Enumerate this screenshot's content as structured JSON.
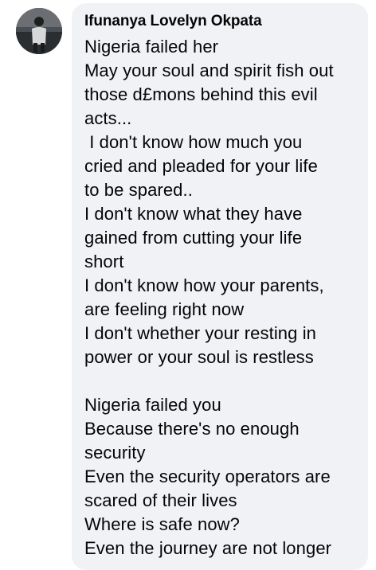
{
  "comment": {
    "avatar_icon": "user-avatar-photo",
    "author": "Ifunanya Lovelyn Okpata",
    "lines": [
      "Nigeria failed her",
      "May your soul and spirit fish out",
      "those d£mons behind this evil",
      "acts...",
      " I don't know how much you",
      "cried and pleaded for your life",
      "to be spared..",
      "I don't know what they have",
      "gained from cutting your life",
      "short",
      "I don't know how your parents,",
      "are feeling right now",
      "I don't whether your resting in",
      "power or your soul is restless",
      "",
      "Nigeria failed you",
      "Because there's no enough",
      "security",
      "Even the security operators are",
      "scared of their lives",
      "Where is safe now?",
      "Even the journey are not longer"
    ]
  },
  "colors": {
    "bubble_background": "#f0f2f5",
    "text": "#050505"
  }
}
